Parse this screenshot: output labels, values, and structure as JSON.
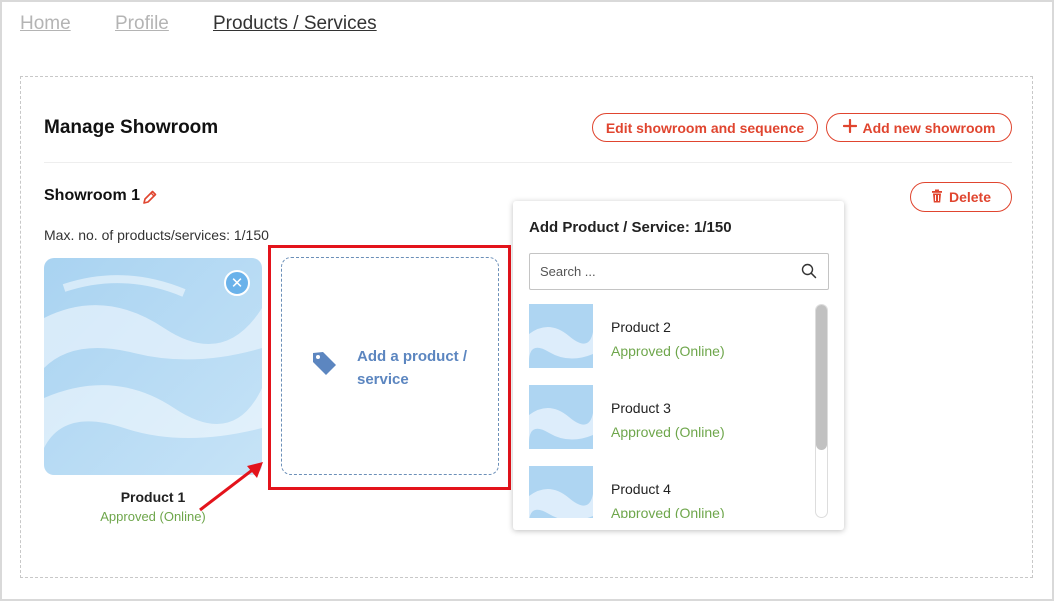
{
  "nav": {
    "home": "Home",
    "profile": "Profile",
    "products": "Products / Services"
  },
  "header": {
    "title": "Manage Showroom",
    "edit_button": "Edit showroom and sequence",
    "add_button": "Add new showroom"
  },
  "showroom": {
    "name": "Showroom 1",
    "max_label": "Max. no. of products/services: 1/150",
    "delete_button": "Delete",
    "product": {
      "name": "Product 1",
      "status": "Approved (Online)"
    },
    "add_card_label": "Add a product / service"
  },
  "dropdown": {
    "title": "Add Product / Service: 1/150",
    "search_placeholder": "Search ...",
    "items": [
      {
        "name": "Product 2",
        "status": "Approved (Online)"
      },
      {
        "name": "Product 3",
        "status": "Approved (Online)"
      },
      {
        "name": "Product 4",
        "status": "Approved (Online)"
      }
    ]
  },
  "colors": {
    "accent": "#e0452f",
    "approved": "#6ea64b",
    "link_blue": "#5c86c0",
    "highlight": "#e3131b"
  }
}
